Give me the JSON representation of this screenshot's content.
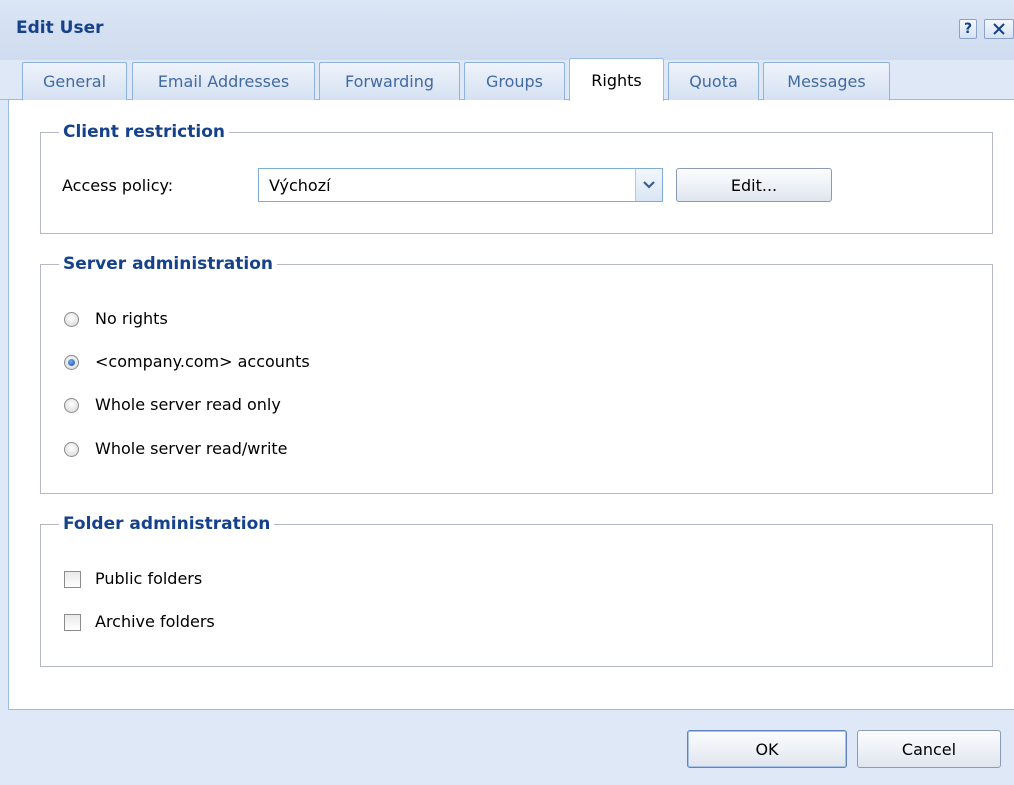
{
  "window": {
    "title": "Edit User",
    "help_label": "?",
    "close_label": "X"
  },
  "tabs": [
    {
      "label": "General"
    },
    {
      "label": "Email Addresses"
    },
    {
      "label": "Forwarding"
    },
    {
      "label": "Groups"
    },
    {
      "label": "Rights",
      "active": true
    },
    {
      "label": "Quota"
    },
    {
      "label": "Messages"
    }
  ],
  "client_restriction": {
    "legend": "Client restriction",
    "access_policy_label": "Access policy:",
    "access_policy_value": "Výchozí",
    "edit_label": "Edit..."
  },
  "server_administration": {
    "legend": "Server administration",
    "options": [
      {
        "label": "No rights",
        "checked": false
      },
      {
        "label": "<company.com> accounts",
        "checked": true
      },
      {
        "label": "Whole server read only",
        "checked": false
      },
      {
        "label": "Whole server read/write",
        "checked": false
      }
    ]
  },
  "folder_administration": {
    "legend": "Folder administration",
    "options": [
      {
        "label": "Public folders",
        "checked": false
      },
      {
        "label": "Archive folders",
        "checked": false
      }
    ]
  },
  "footer": {
    "ok_label": "OK",
    "cancel_label": "Cancel"
  },
  "colors": {
    "accent": "#15428b",
    "panel_border": "#99bbe8",
    "background": "#dfe8f6"
  }
}
